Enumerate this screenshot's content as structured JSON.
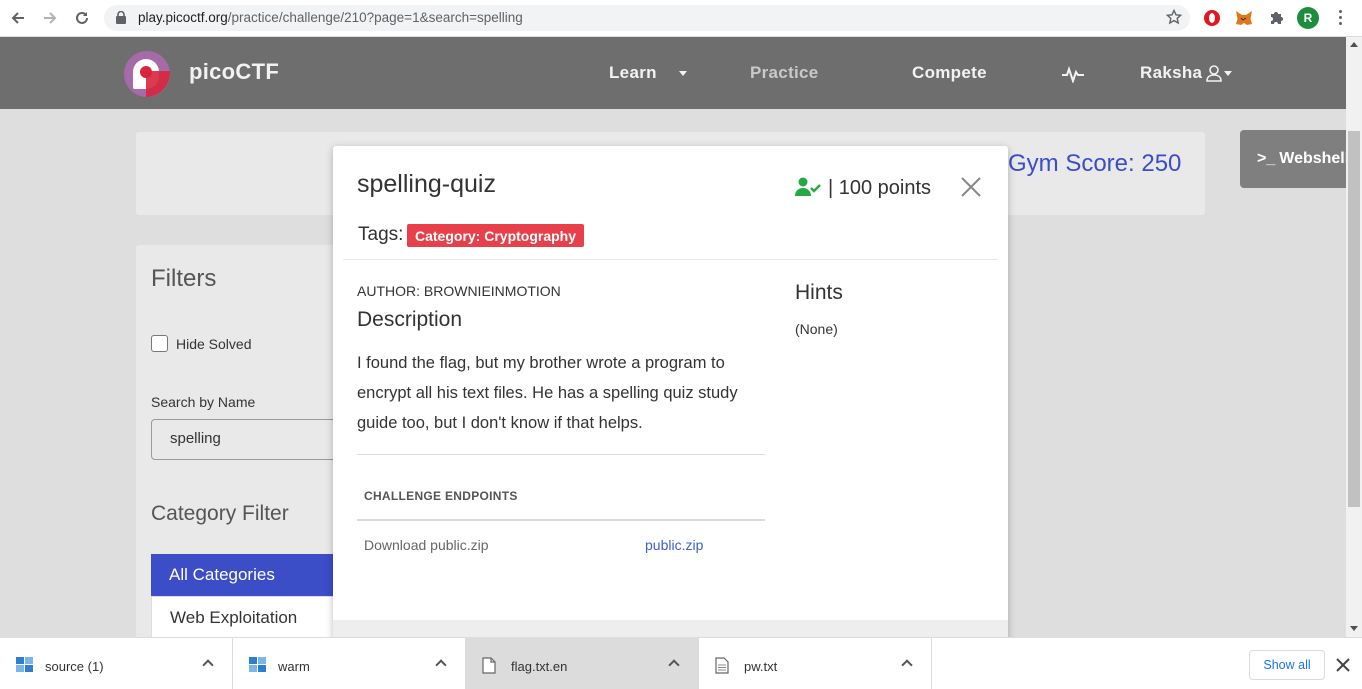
{
  "browser": {
    "url_host": "play.picoctf.org",
    "url_path": "/practice/challenge/210?page=1&search=spelling",
    "profile_initial": "R",
    "icons": [
      "back-icon",
      "forward-icon",
      "reload-icon",
      "lock-icon",
      "star-icon",
      "opera-icon",
      "metamask-icon",
      "extensions-icon",
      "menu-icon"
    ]
  },
  "navbar": {
    "brand": "picoCTF",
    "links": {
      "learn": "Learn",
      "practice": "Practice",
      "compete": "Compete"
    },
    "user": "Raksha"
  },
  "score": {
    "label": "Gym Score: 250"
  },
  "filters": {
    "title": "Filters",
    "hide_solved": "Hide Solved",
    "search_label": "Search by Name",
    "search_value": "spelling",
    "category_title": "Category Filter",
    "categories": [
      "All Categories",
      "Web Exploitation"
    ]
  },
  "webshell": {
    "label": "Webshell",
    "prompt": ">_"
  },
  "modal": {
    "title": "spelling-quiz",
    "points": "| 100 points",
    "tags_label": "Tags:",
    "tag": "Category: Cryptography",
    "author": "AUTHOR: BROWNIEINMOTION",
    "description_heading": "Description",
    "description": "I found the flag, but my brother wrote a program to encrypt all his text files. He has a spelling quiz study guide too, but I don't know if that helps.",
    "endpoints_heading": "CHALLENGE ENDPOINTS",
    "download_label": "Download public.zip",
    "download_link": "public.zip",
    "hints_heading": "Hints",
    "hints_value": "(None)"
  },
  "downloads": {
    "items": [
      {
        "name": "source (1)",
        "icon": "archive-icon"
      },
      {
        "name": "warm",
        "icon": "archive-icon"
      },
      {
        "name": "flag.txt.en",
        "icon": "file-icon"
      },
      {
        "name": "pw.txt",
        "icon": "text-file-icon"
      }
    ],
    "show_all": "Show all"
  },
  "colors": {
    "navbar": "#6e6e6e",
    "accent_blue": "#3b4dc7",
    "tag_red": "#e8404a",
    "solved_green": "#27a844"
  }
}
